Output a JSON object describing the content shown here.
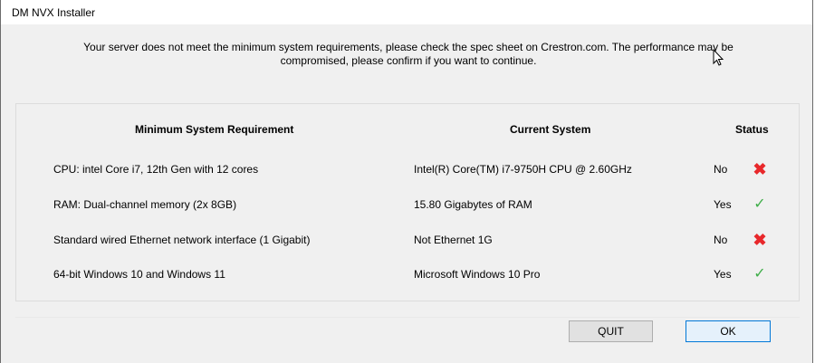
{
  "window": {
    "title": "DM NVX Installer"
  },
  "message": {
    "line1": "Your server does not meet the minimum system requirements, please check the spec sheet on Crestron.com. The performance may be",
    "line2": "compromised, please confirm if you want to continue."
  },
  "table": {
    "headers": {
      "requirement": "Minimum System Requirement",
      "current": "Current System",
      "status": "Status"
    },
    "rows": [
      {
        "requirement": "CPU: intel Core i7, 12th Gen with 12 cores",
        "current": "Intel(R) Core(TM) i7-9750H CPU @ 2.60GHz",
        "status": "No",
        "icon": "cross-icon"
      },
      {
        "requirement": "RAM: Dual-channel memory (2x 8GB)",
        "current": "15.80 Gigabytes of RAM",
        "status": "Yes",
        "icon": "check-icon"
      },
      {
        "requirement": "Standard wired Ethernet network interface (1 Gigabit)",
        "current": "Not Ethernet 1G",
        "status": "No",
        "icon": "cross-icon"
      },
      {
        "requirement": "64-bit Windows 10 and Windows 11",
        "current": "Microsoft Windows 10 Pro",
        "status": "Yes",
        "icon": "check-icon"
      }
    ]
  },
  "buttons": {
    "quit": "QUIT",
    "ok": "OK"
  },
  "colors": {
    "fail": "#e8282b",
    "pass": "#3fae49",
    "focus_border": "#0078d7"
  }
}
